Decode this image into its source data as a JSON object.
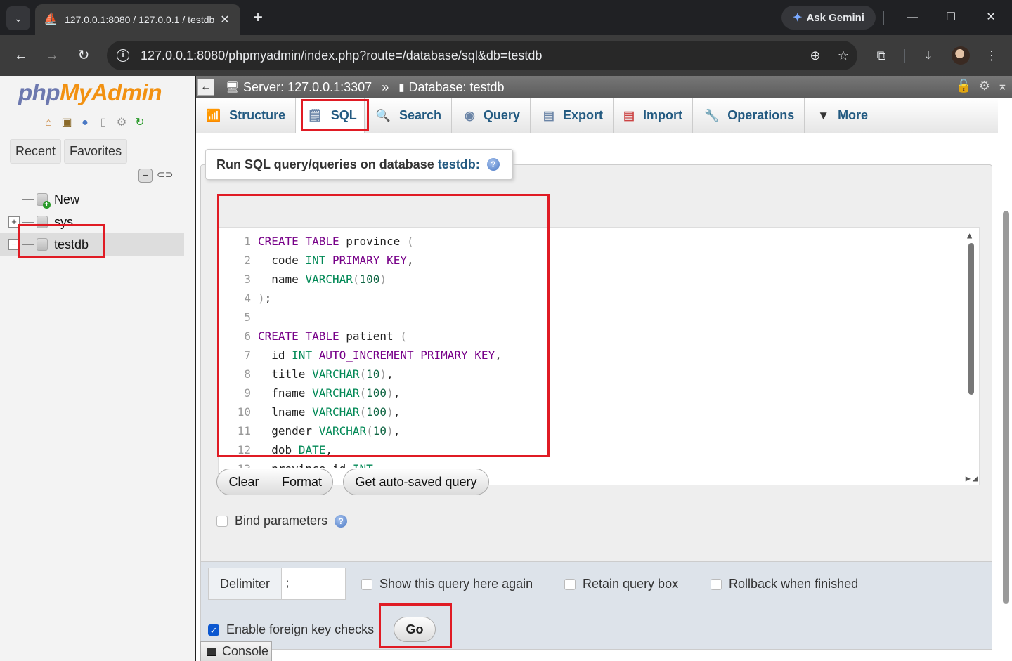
{
  "browser": {
    "tab_title": "127.0.0.1:8080 / 127.0.0.1 / testdb",
    "tab_close": "✕",
    "new_tab": "+",
    "ask_gemini": "Ask Gemini",
    "url": "127.0.0.1:8080/phpmyadmin/index.php?route=/database/sql&db=testdb"
  },
  "sidebar": {
    "logo_php": "php",
    "logo_my": "My",
    "logo_admin": "Admin",
    "recent": "Recent",
    "favorites": "Favorites",
    "tree": [
      {
        "label": "New"
      },
      {
        "label": "sys"
      },
      {
        "label": "testdb"
      }
    ]
  },
  "serverbar": {
    "server": "Server: 127.0.0.1:3307",
    "separator": "»",
    "database": "Database: testdb"
  },
  "tabs": [
    {
      "label": "Structure"
    },
    {
      "label": "SQL"
    },
    {
      "label": "Search"
    },
    {
      "label": "Query"
    },
    {
      "label": "Export"
    },
    {
      "label": "Import"
    },
    {
      "label": "Operations"
    },
    {
      "label": "More"
    }
  ],
  "query_panel": {
    "legend": "Run SQL query/queries on database",
    "db_link": "testdb:",
    "code_lines": [
      "CREATE TABLE province (",
      "  code INT PRIMARY KEY,",
      "  name VARCHAR(100)",
      ");",
      "",
      "CREATE TABLE patient (",
      "  id INT AUTO_INCREMENT PRIMARY KEY,",
      "  title VARCHAR(10),",
      "  fname VARCHAR(100),",
      "  lname VARCHAR(100),",
      "  gender VARCHAR(10),",
      "  dob DATE,",
      "  province_id INT"
    ],
    "clear": "Clear",
    "format": "Format",
    "autosaved": "Get auto-saved query",
    "bind_params": "Bind parameters"
  },
  "bottom": {
    "delimiter_label": "Delimiter",
    "delimiter_value": ";",
    "show_again": "Show this query here again",
    "retain": "Retain query box",
    "rollback": "Rollback when finished",
    "fk_checks": "Enable foreign key checks",
    "fk_checks_checked": true,
    "go": "Go"
  },
  "console": "Console"
}
